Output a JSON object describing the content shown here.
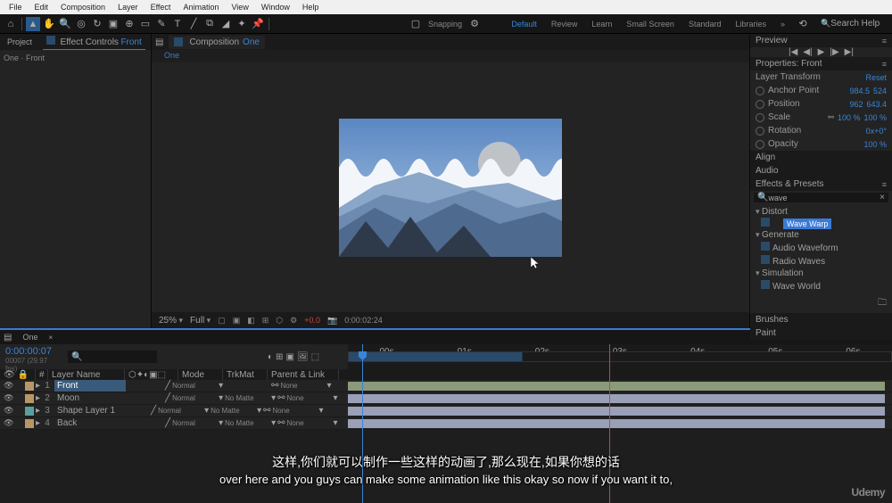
{
  "menu": [
    "File",
    "Edit",
    "Composition",
    "Layer",
    "Effect",
    "Animation",
    "View",
    "Window",
    "Help"
  ],
  "toolbar": {
    "snapping": "Snapping"
  },
  "workspaces": [
    "Default",
    "Review",
    "Learn",
    "Small Screen",
    "Standard",
    "Libraries"
  ],
  "search_help": "Search Help",
  "left": {
    "tab_project": "Project",
    "tab_ec": "Effect Controls",
    "ec_target": "Front",
    "breadcrumb": "One · Front"
  },
  "comp": {
    "name": "Composition",
    "comp_name": "One",
    "sub": "One"
  },
  "viewer": {
    "zoom": "25%",
    "res": "Full",
    "time": "0:00:02:24"
  },
  "preview": {
    "title": "Preview"
  },
  "props": {
    "title": "Properties:",
    "target": "Front",
    "section": "Layer Transform",
    "reset": "Reset",
    "anchor": "Anchor Point",
    "anchor_v": "984.5",
    "anchor_v2": "524",
    "position": "Position",
    "pos_v": "962",
    "pos_v2": "643.4",
    "scale": "Scale",
    "scale_v": "100 %",
    "scale_v2": "100 %",
    "rotation": "Rotation",
    "rot_v": "0x+0°",
    "opacity": "Opacity",
    "op_v": "100 %"
  },
  "align": {
    "title": "Align"
  },
  "audio": {
    "title": "Audio"
  },
  "ep": {
    "title": "Effects & Presets",
    "search": "wave",
    "cat_distort": "Distort",
    "wave_warp": "Wave Warp",
    "cat_gen": "Generate",
    "audio_wave": "Audio Waveform",
    "radio": "Radio Waves",
    "cat_sim": "Simulation",
    "wave_world": "Wave World"
  },
  "brushes": {
    "title": "Brushes"
  },
  "paint": {
    "title": "Paint"
  },
  "tl": {
    "tab": "One",
    "tc": "0:00:00:07",
    "frame": "00007 (29.97 fps)",
    "col_num": "#",
    "col_name": "Layer Name",
    "col_mode": "Mode",
    "col_trk": "TrkMat",
    "col_parent": "Parent & Link",
    "t_00s": "00s",
    "t_01s": "01s",
    "t_02s": "02s",
    "t_03s": "03s",
    "t_04s": "04s",
    "t_05s": "05s",
    "t_06s": "06s",
    "layers": [
      {
        "n": "1",
        "name": "Front",
        "mode": "Normal",
        "trk": "",
        "color": "#b89668"
      },
      {
        "n": "2",
        "name": "Moon",
        "mode": "Normal",
        "trk": "No Matte",
        "color": "#b89668"
      },
      {
        "n": "3",
        "name": "Shape Layer 1",
        "mode": "Normal",
        "trk": "No Matte",
        "color": "#5a9e9e"
      },
      {
        "n": "4",
        "name": "Back",
        "mode": "Normal",
        "trk": "No Matte",
        "color": "#b89668"
      }
    ],
    "none": "None"
  },
  "subtitle": {
    "cn": "这样,你们就可以制作一些这样的动画了,那么现在,如果你想的话",
    "en": "over here and you guys can make some animation like this okay so now if you want it to,"
  },
  "watermark": "Udemy"
}
